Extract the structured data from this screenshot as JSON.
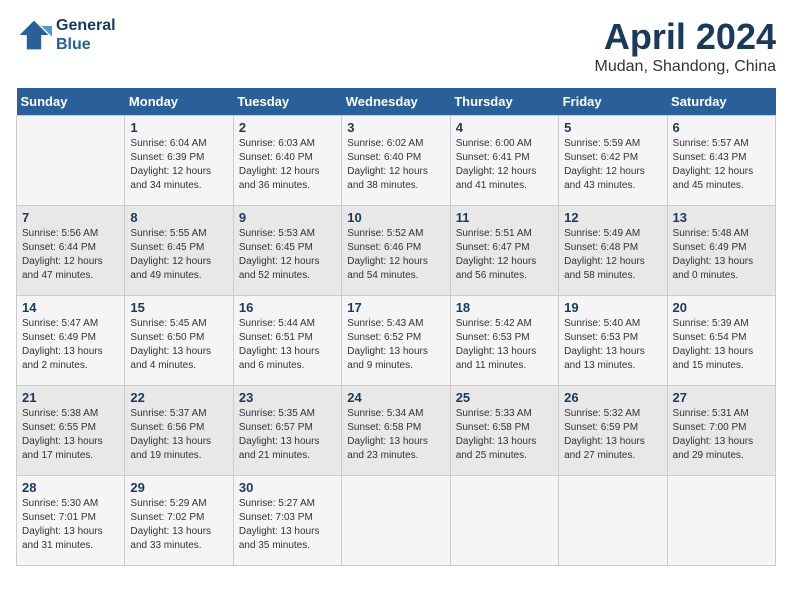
{
  "header": {
    "logo_line1": "General",
    "logo_line2": "Blue",
    "month_title": "April 2024",
    "location": "Mudan, Shandong, China"
  },
  "days_of_week": [
    "Sunday",
    "Monday",
    "Tuesday",
    "Wednesday",
    "Thursday",
    "Friday",
    "Saturday"
  ],
  "weeks": [
    [
      {
        "day": "",
        "info": ""
      },
      {
        "day": "1",
        "info": "Sunrise: 6:04 AM\nSunset: 6:39 PM\nDaylight: 12 hours\nand 34 minutes."
      },
      {
        "day": "2",
        "info": "Sunrise: 6:03 AM\nSunset: 6:40 PM\nDaylight: 12 hours\nand 36 minutes."
      },
      {
        "day": "3",
        "info": "Sunrise: 6:02 AM\nSunset: 6:40 PM\nDaylight: 12 hours\nand 38 minutes."
      },
      {
        "day": "4",
        "info": "Sunrise: 6:00 AM\nSunset: 6:41 PM\nDaylight: 12 hours\nand 41 minutes."
      },
      {
        "day": "5",
        "info": "Sunrise: 5:59 AM\nSunset: 6:42 PM\nDaylight: 12 hours\nand 43 minutes."
      },
      {
        "day": "6",
        "info": "Sunrise: 5:57 AM\nSunset: 6:43 PM\nDaylight: 12 hours\nand 45 minutes."
      }
    ],
    [
      {
        "day": "7",
        "info": "Sunrise: 5:56 AM\nSunset: 6:44 PM\nDaylight: 12 hours\nand 47 minutes."
      },
      {
        "day": "8",
        "info": "Sunrise: 5:55 AM\nSunset: 6:45 PM\nDaylight: 12 hours\nand 49 minutes."
      },
      {
        "day": "9",
        "info": "Sunrise: 5:53 AM\nSunset: 6:45 PM\nDaylight: 12 hours\nand 52 minutes."
      },
      {
        "day": "10",
        "info": "Sunrise: 5:52 AM\nSunset: 6:46 PM\nDaylight: 12 hours\nand 54 minutes."
      },
      {
        "day": "11",
        "info": "Sunrise: 5:51 AM\nSunset: 6:47 PM\nDaylight: 12 hours\nand 56 minutes."
      },
      {
        "day": "12",
        "info": "Sunrise: 5:49 AM\nSunset: 6:48 PM\nDaylight: 12 hours\nand 58 minutes."
      },
      {
        "day": "13",
        "info": "Sunrise: 5:48 AM\nSunset: 6:49 PM\nDaylight: 13 hours\nand 0 minutes."
      }
    ],
    [
      {
        "day": "14",
        "info": "Sunrise: 5:47 AM\nSunset: 6:49 PM\nDaylight: 13 hours\nand 2 minutes."
      },
      {
        "day": "15",
        "info": "Sunrise: 5:45 AM\nSunset: 6:50 PM\nDaylight: 13 hours\nand 4 minutes."
      },
      {
        "day": "16",
        "info": "Sunrise: 5:44 AM\nSunset: 6:51 PM\nDaylight: 13 hours\nand 6 minutes."
      },
      {
        "day": "17",
        "info": "Sunrise: 5:43 AM\nSunset: 6:52 PM\nDaylight: 13 hours\nand 9 minutes."
      },
      {
        "day": "18",
        "info": "Sunrise: 5:42 AM\nSunset: 6:53 PM\nDaylight: 13 hours\nand 11 minutes."
      },
      {
        "day": "19",
        "info": "Sunrise: 5:40 AM\nSunset: 6:53 PM\nDaylight: 13 hours\nand 13 minutes."
      },
      {
        "day": "20",
        "info": "Sunrise: 5:39 AM\nSunset: 6:54 PM\nDaylight: 13 hours\nand 15 minutes."
      }
    ],
    [
      {
        "day": "21",
        "info": "Sunrise: 5:38 AM\nSunset: 6:55 PM\nDaylight: 13 hours\nand 17 minutes."
      },
      {
        "day": "22",
        "info": "Sunrise: 5:37 AM\nSunset: 6:56 PM\nDaylight: 13 hours\nand 19 minutes."
      },
      {
        "day": "23",
        "info": "Sunrise: 5:35 AM\nSunset: 6:57 PM\nDaylight: 13 hours\nand 21 minutes."
      },
      {
        "day": "24",
        "info": "Sunrise: 5:34 AM\nSunset: 6:58 PM\nDaylight: 13 hours\nand 23 minutes."
      },
      {
        "day": "25",
        "info": "Sunrise: 5:33 AM\nSunset: 6:58 PM\nDaylight: 13 hours\nand 25 minutes."
      },
      {
        "day": "26",
        "info": "Sunrise: 5:32 AM\nSunset: 6:59 PM\nDaylight: 13 hours\nand 27 minutes."
      },
      {
        "day": "27",
        "info": "Sunrise: 5:31 AM\nSunset: 7:00 PM\nDaylight: 13 hours\nand 29 minutes."
      }
    ],
    [
      {
        "day": "28",
        "info": "Sunrise: 5:30 AM\nSunset: 7:01 PM\nDaylight: 13 hours\nand 31 minutes."
      },
      {
        "day": "29",
        "info": "Sunrise: 5:29 AM\nSunset: 7:02 PM\nDaylight: 13 hours\nand 33 minutes."
      },
      {
        "day": "30",
        "info": "Sunrise: 5:27 AM\nSunset: 7:03 PM\nDaylight: 13 hours\nand 35 minutes."
      },
      {
        "day": "",
        "info": ""
      },
      {
        "day": "",
        "info": ""
      },
      {
        "day": "",
        "info": ""
      },
      {
        "day": "",
        "info": ""
      }
    ]
  ]
}
